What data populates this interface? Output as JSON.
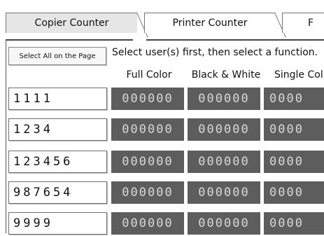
{
  "tabs": [
    {
      "label": "Copier Counter",
      "active": true
    },
    {
      "label": "Printer Counter",
      "active": false
    },
    {
      "label": "F",
      "active": false
    }
  ],
  "select_all_label": "Select All on the Page",
  "instruction": "Select user(s) first, then select a function.",
  "columns": [
    "Full Color",
    "Black & White",
    "Single Col"
  ],
  "users": [
    {
      "id": "1111",
      "full_color": "000000",
      "black_white": "000000",
      "single_color": "0000"
    },
    {
      "id": "1234",
      "full_color": "000000",
      "black_white": "000000",
      "single_color": "0000"
    },
    {
      "id": "123456",
      "full_color": "000000",
      "black_white": "000000",
      "single_color": "0000"
    },
    {
      "id": "987654",
      "full_color": "000000",
      "black_white": "000000",
      "single_color": "0000"
    },
    {
      "id": "9999",
      "full_color": "000000",
      "black_white": "000000",
      "single_color": "0000"
    }
  ]
}
